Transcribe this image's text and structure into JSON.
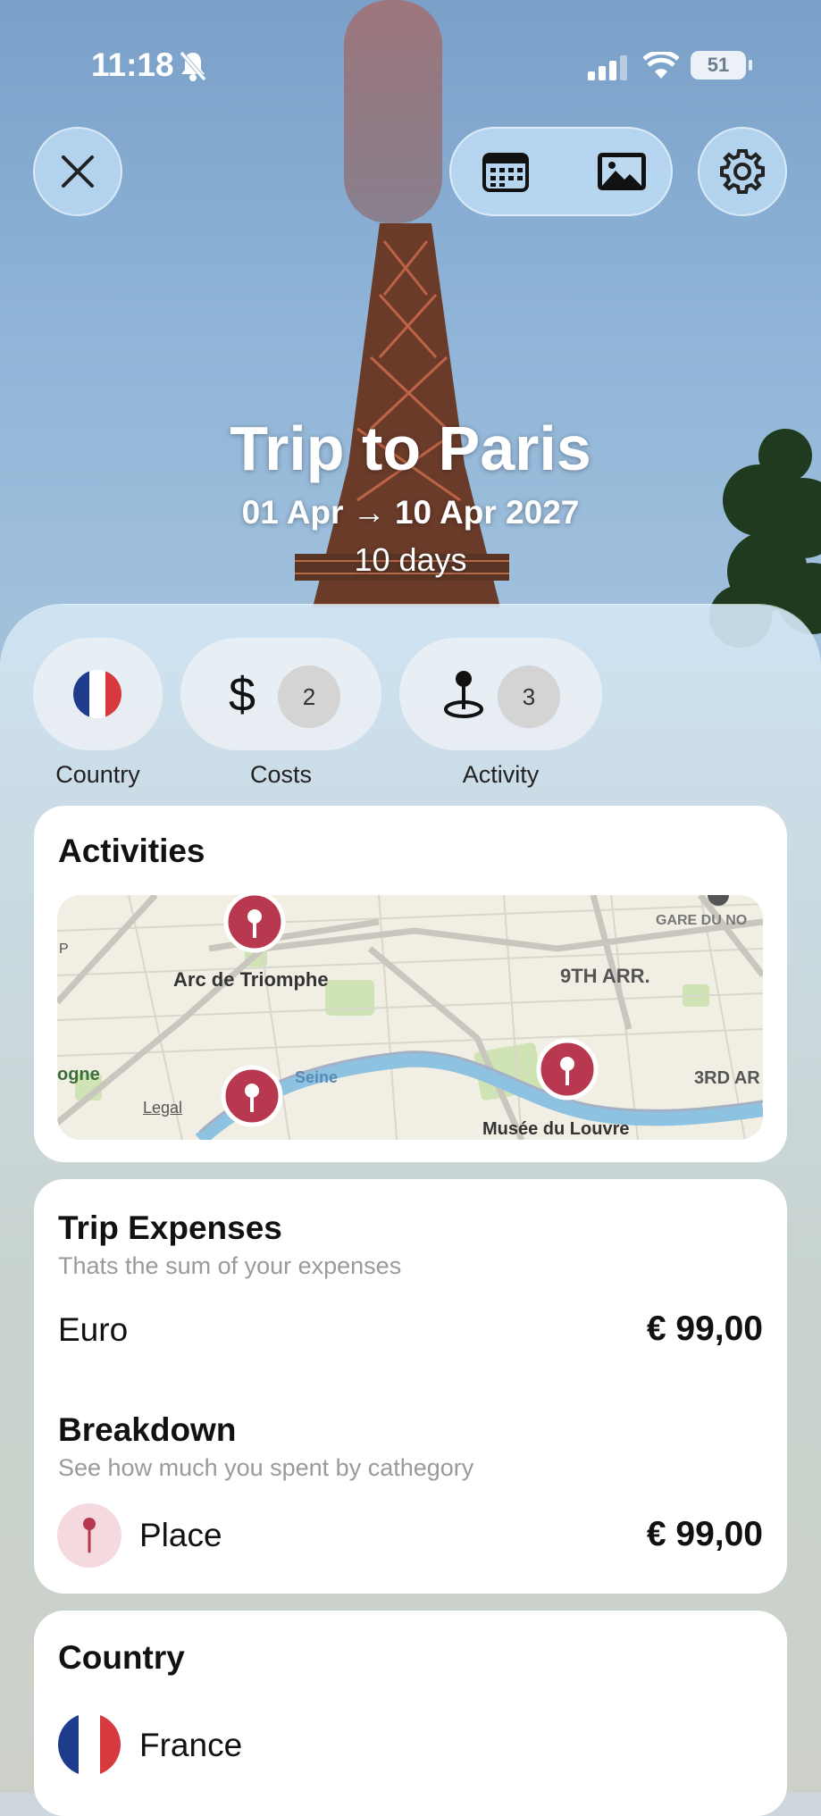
{
  "status_bar": {
    "time": "11:18",
    "battery": "51"
  },
  "trip": {
    "title": "Trip to Paris",
    "dates": "01 Apr → 10 Apr 2027",
    "duration": "10 days"
  },
  "chips": {
    "country_label": "Country",
    "costs_label": "Costs",
    "costs_count": "2",
    "activity_label": "Activity",
    "activity_count": "3"
  },
  "activities": {
    "title": "Activities",
    "map": {
      "labels": {
        "arc": "Arc de Triomphe",
        "arr9": "9TH ARR.",
        "gare": "GARE DU NO",
        "seine": "Seine",
        "logne": "ogne",
        "legal": "Legal",
        "louvre": "Musée du Louvre",
        "arr3": "3RD AR",
        "p": "P"
      }
    }
  },
  "expenses": {
    "title": "Trip Expenses",
    "subtitle": "Thats the sum of your expenses",
    "currency_label": "Euro",
    "currency_total": "€ 99,00",
    "breakdown_title": "Breakdown",
    "breakdown_subtitle": "See how much you spent by cathegory",
    "category_label": "Place",
    "category_total": "€ 99,00"
  },
  "country": {
    "title": "Country",
    "name": "France"
  },
  "colors": {
    "pin": "#b8394f",
    "france_blue": "#1f3b8c",
    "france_red": "#d63a3f",
    "card_bg": "#ffffff"
  },
  "icons": [
    "close-icon",
    "calendar-icon",
    "image-icon",
    "gear-icon",
    "dollar-icon",
    "pin-icon",
    "france-flag-icon"
  ]
}
